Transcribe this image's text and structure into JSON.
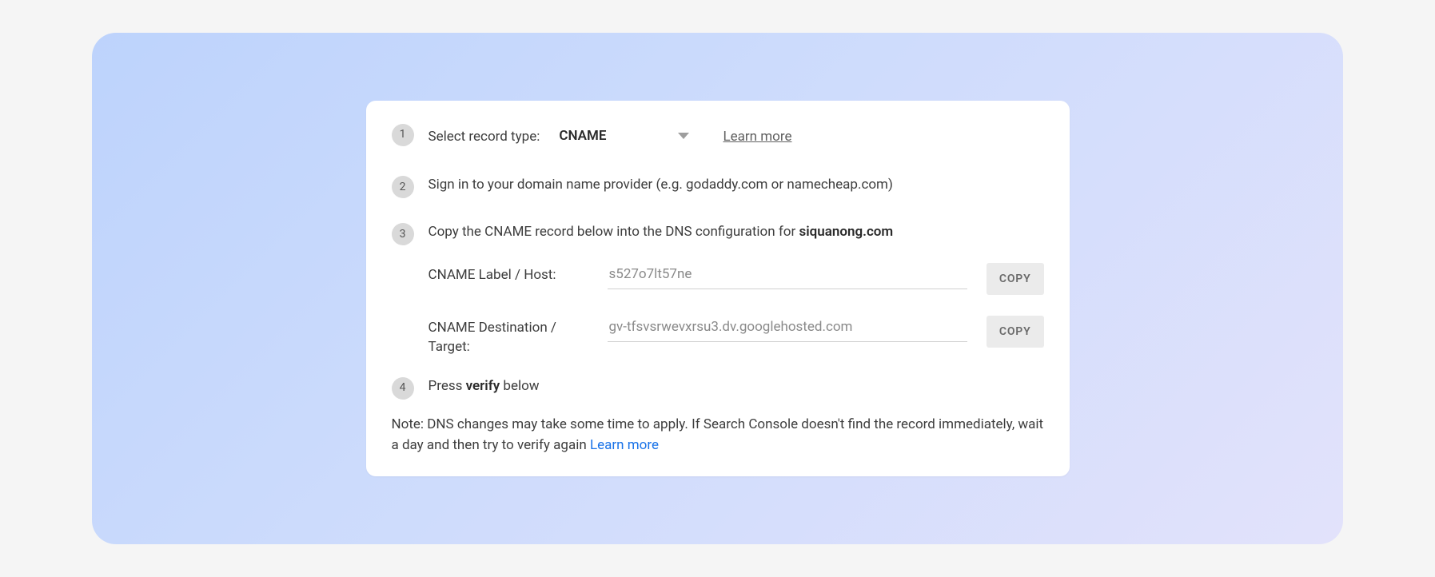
{
  "steps": {
    "s1": {
      "num": "1",
      "label": "Select record type:",
      "select_value": "CNAME",
      "learn_more": "Learn more"
    },
    "s2": {
      "num": "2",
      "text": "Sign in to your domain name provider (e.g. godaddy.com or namecheap.com)"
    },
    "s3": {
      "num": "3",
      "prefix": "Copy the CNAME record below into the DNS configuration for ",
      "domain": "siquanong.com"
    },
    "s4": {
      "num": "4",
      "prefix": "Press ",
      "bold": "verify",
      "suffix": " below"
    }
  },
  "fields": {
    "label_host": {
      "label": "CNAME Label / Host:",
      "value": "s527o7lt57ne",
      "copy": "COPY"
    },
    "destination": {
      "label": "CNAME Destination / Target:",
      "value": "gv-tfsvsrwevxrsu3.dv.googlehosted.com",
      "copy": "COPY"
    }
  },
  "note": {
    "text": "Note: DNS changes may take some time to apply. If Search Console doesn't find the record immediately, wait a day and then try to verify again ",
    "link": "Learn more"
  }
}
